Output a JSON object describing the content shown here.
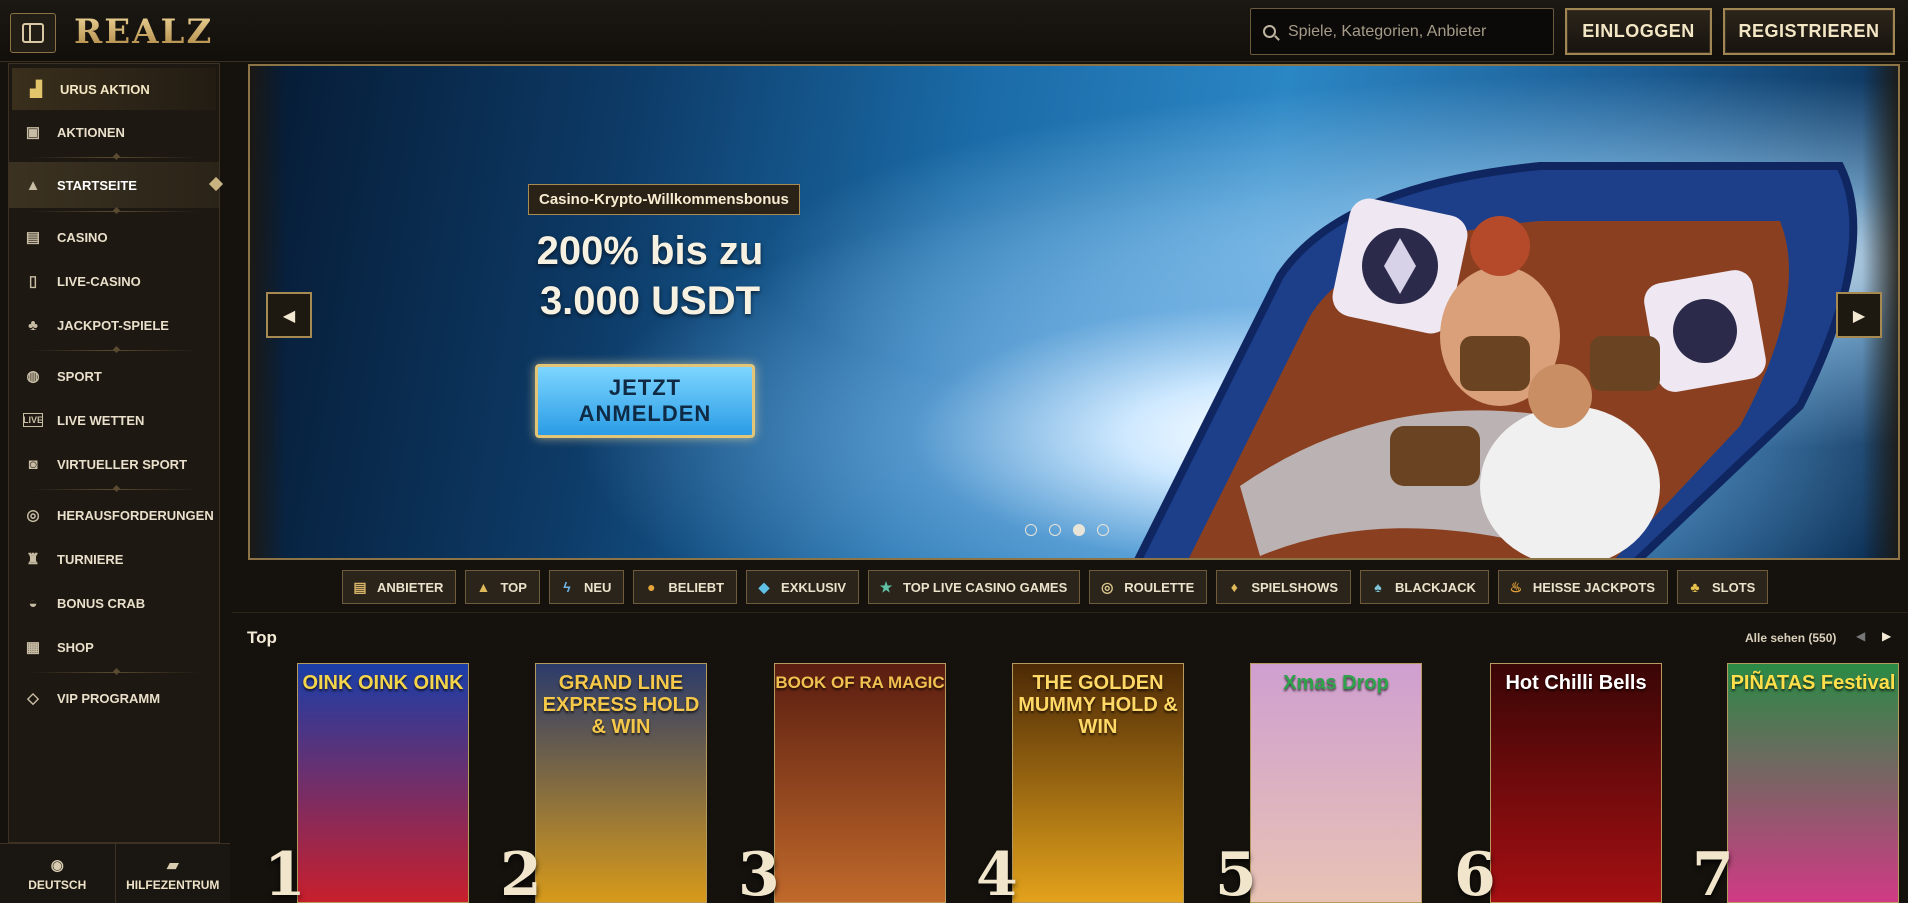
{
  "header": {
    "logo": "REALZ",
    "search_placeholder": "Spiele, Kategorien, Anbieter",
    "login_label": "EINLOGGEN",
    "register_label": "REGISTRIEREN"
  },
  "sidebar": {
    "items": [
      {
        "label": "URUS AKTION",
        "icon": "car-icon"
      },
      {
        "label": "AKTIONEN",
        "icon": "gift-icon"
      },
      {
        "label": "STARTSEITE",
        "icon": "pyramid-icon"
      },
      {
        "label": "CASINO",
        "icon": "slot-machine-icon"
      },
      {
        "label": "LIVE-CASINO",
        "icon": "cards-icon"
      },
      {
        "label": "JACKPOT-SPIELE",
        "icon": "clover-icon"
      },
      {
        "label": "SPORT",
        "icon": "ball-icon"
      },
      {
        "label": "LIVE WETTEN",
        "icon": "live-icon"
      },
      {
        "label": "VIRTUELLER SPORT",
        "icon": "virtual-sport-icon"
      },
      {
        "label": "HERAUSFORDERUNGEN",
        "icon": "challenge-icon"
      },
      {
        "label": "TURNIERE",
        "icon": "trophy-icon"
      },
      {
        "label": "BONUS CRAB",
        "icon": "crab-icon"
      },
      {
        "label": "SHOP",
        "icon": "shop-icon"
      },
      {
        "label": "VIP PROGRAMM",
        "icon": "diamond-icon"
      }
    ],
    "footer": {
      "language_label": "DEUTSCH",
      "help_label": "HILFEZENTRUM"
    }
  },
  "hero": {
    "tag": "Casino-Krypto-Willkommensbonus",
    "title_line1": "200% bis zu",
    "title_line2": "3.000 USDT",
    "cta_line1": "JETZT",
    "cta_line2": "ANMELDEN",
    "slide_count": 4,
    "active_slide": 3
  },
  "categories": [
    {
      "label": "ANBIETER",
      "icon": "scroll-icon"
    },
    {
      "label": "TOP",
      "icon": "pyramid-icon"
    },
    {
      "label": "NEU",
      "icon": "lightning-icon"
    },
    {
      "label": "BELIEBT",
      "icon": "drop-icon"
    },
    {
      "label": "EXKLUSIV",
      "icon": "diamond-icon"
    },
    {
      "label": "TOP LIVE CASINO GAMES",
      "icon": "star-icon"
    },
    {
      "label": "ROULETTE",
      "icon": "roulette-icon"
    },
    {
      "label": "SPIELSHOWS",
      "icon": "microphone-icon"
    },
    {
      "label": "BLACKJACK",
      "icon": "cards-icon"
    },
    {
      "label": "HEISSE JACKPOTS",
      "icon": "chili-icon"
    },
    {
      "label": "SLOTS",
      "icon": "cherries-icon"
    }
  ],
  "games_section": {
    "title": "Top",
    "see_all": "Alle sehen (550)",
    "games": [
      {
        "rank": "1",
        "title": "OINK OINK OINK",
        "colors": [
          "#1a3ea8",
          "#c81f2c"
        ]
      },
      {
        "rank": "2",
        "title": "GRAND LINE EXPRESS HOLD & WIN",
        "colors": [
          "#2b3b6a",
          "#d79a1a"
        ]
      },
      {
        "rank": "3",
        "title": "BOOK OF RA MAGIC",
        "colors": [
          "#5a1d10",
          "#c0692b"
        ]
      },
      {
        "rank": "4",
        "title": "THE GOLDEN MUMMY HOLD & WIN",
        "colors": [
          "#4d2a06",
          "#e3a21c"
        ]
      },
      {
        "rank": "5",
        "title": "Xmas Drop",
        "colors": [
          "#cf9fd0",
          "#e8c3b4"
        ]
      },
      {
        "rank": "6",
        "title": "Hot Chilli Bells",
        "colors": [
          "#3a0606",
          "#a50f12"
        ]
      },
      {
        "rank": "7",
        "title": "PIÑATAS Festival",
        "colors": [
          "#2a8a45",
          "#d03a85"
        ]
      }
    ]
  }
}
